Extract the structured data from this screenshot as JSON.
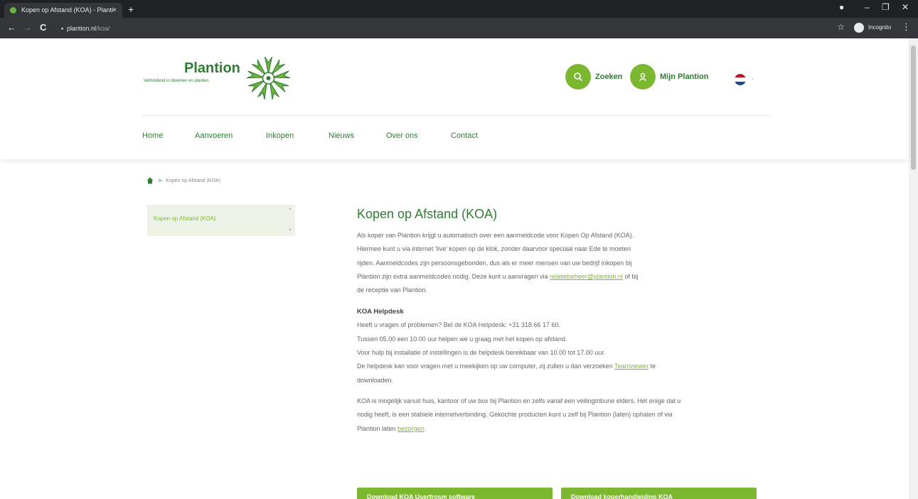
{
  "browser": {
    "tab_title": "Kopen op Afstand (KOA) - Planti",
    "tab_close": "×",
    "new_tab": "+",
    "url_host": "plantion.nl",
    "url_path": "/koa/",
    "incognito_label": "Incognito",
    "back": "←",
    "forward": "→",
    "reload": "C",
    "minimize": "–",
    "maximize": "❐",
    "close": "✕"
  },
  "logo": {
    "name": "Plantion",
    "tagline": "Verbindend in bloemen en planten"
  },
  "header": {
    "search_label": "Zoeken",
    "account_label": "Mijn Plantion",
    "language_flag_colors": [
      "#ae1c28",
      "#ffffff",
      "#21468b"
    ]
  },
  "nav": {
    "items": [
      "Home",
      "Aanvoeren",
      "Inkopen",
      "Nieuws",
      "Over ons",
      "Contact"
    ]
  },
  "breadcrumb": {
    "separator": ">",
    "current": "Kopen op Afstand (KOA)"
  },
  "sidebar": {
    "items": [
      {
        "label": "Kopen op Afstand (KOA)"
      }
    ]
  },
  "main": {
    "title": "Kopen op Afstand (KOA)",
    "intro_lines": [
      "Als koper van Plantion krijgt u automatisch over een aanmeldcode voor Kopen Op Afstand (KOA).",
      "Hiermee kunt u via internet 'live' kopen op de klok, zonder daarvoor speciaal naar Ede te moeten",
      "rijden. Aanmeldcodes zijn persoonsgebonden, dus als er meer mensen van uw bedrijf inkopen bij"
    ],
    "intro_line4_pre": "Plantion zijn extra aanmeldcodes nodig. Deze kunt u aanvragen via ",
    "intro_email": "relatiebeheer@plantion.nl",
    "intro_line4_post": " of bij",
    "intro_line5": "de receptie van Plantion.",
    "helpdesk_heading": "KOA Helpdesk",
    "helpdesk_lines": [
      "Heeft u vragen of problemen? Bel de KOA Helpdesk: +31 318 66 17 60.",
      "Tussen 05.00 een 10.00 uur helpen we u graag met het kopen op afstand.",
      "Voor hulp bij installatie of instellingen is de helpdesk bereikbaar van 10.00 tot 17.00 uur."
    ],
    "helpdesk_line4_pre": "De helpdesk kan voor vragen met u meekijken op uw computer, zij zullen u dan verzoeken ",
    "teamviewer_link": "Teamviewer",
    "helpdesk_line4_post": " te",
    "helpdesk_line5": "downloaden.",
    "koa_lines": [
      "KOA is mogelijk vanuit huis, kantoor of uw box bij Plantion en zelfs vanaf een veilingtribune elders. Het enige dat u",
      "nodig heeft, is een stabiele internetverbinding. Gekochte producten kunt u zelf bij Plantion (laten) ophalen of via"
    ],
    "koa_line3_pre": "Plantion laten ",
    "bezorgen_link": "bezorgen",
    "koa_line3_post": ".",
    "download_software": "Download KOA Userfrosm software",
    "download_manual": "Download koperhandleiding KOA"
  },
  "colors": {
    "brand_green": "#7cb82f",
    "dark_green": "#2e7d32"
  }
}
